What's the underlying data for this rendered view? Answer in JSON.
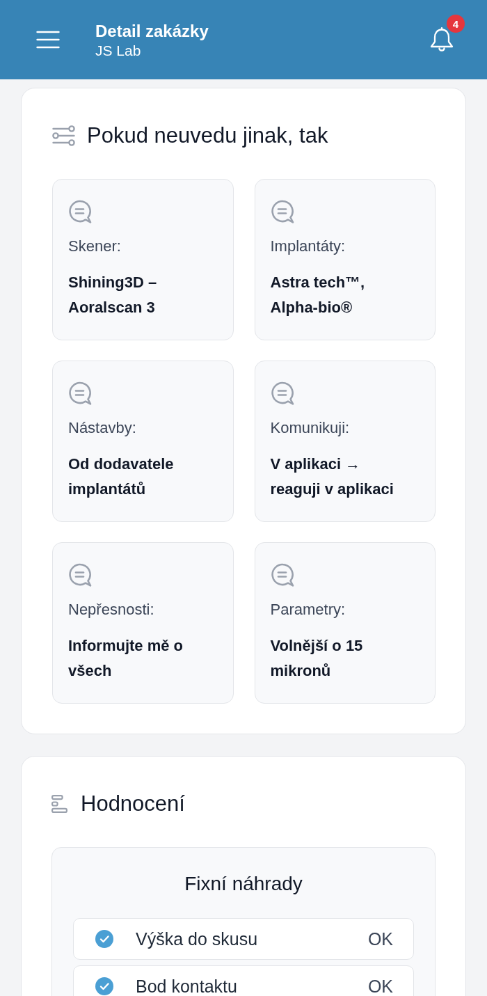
{
  "header": {
    "title": "Detail zakázky",
    "subtitle": "JS Lab",
    "notification_count": "4"
  },
  "defaults_card": {
    "title": "Pokud neuvedu jinak, tak",
    "items": [
      {
        "label": "Skener:",
        "value": "Shining3D – Aoralscan 3"
      },
      {
        "label": "Implantáty:",
        "value": "Astra tech™, Alpha-bio®"
      },
      {
        "label": "Nástavby:",
        "value": "Od dodavatele implantátů"
      },
      {
        "label": "Komunikuji:",
        "value": "V aplikaci → reaguji v aplikaci"
      },
      {
        "label": "Nepřesnosti:",
        "value": "Informujte mě o všech"
      },
      {
        "label": "Parametry:",
        "value": "Volnější o 15 mikronů"
      }
    ]
  },
  "rating_card": {
    "title": "Hodnocení",
    "sections": [
      {
        "title": "Fixní náhrady",
        "rows": [
          {
            "label": "Výška do skusu",
            "checked": true,
            "result": "OK"
          },
          {
            "label": "Bod kontaktu",
            "checked": true,
            "result": "OK"
          }
        ]
      }
    ]
  }
}
